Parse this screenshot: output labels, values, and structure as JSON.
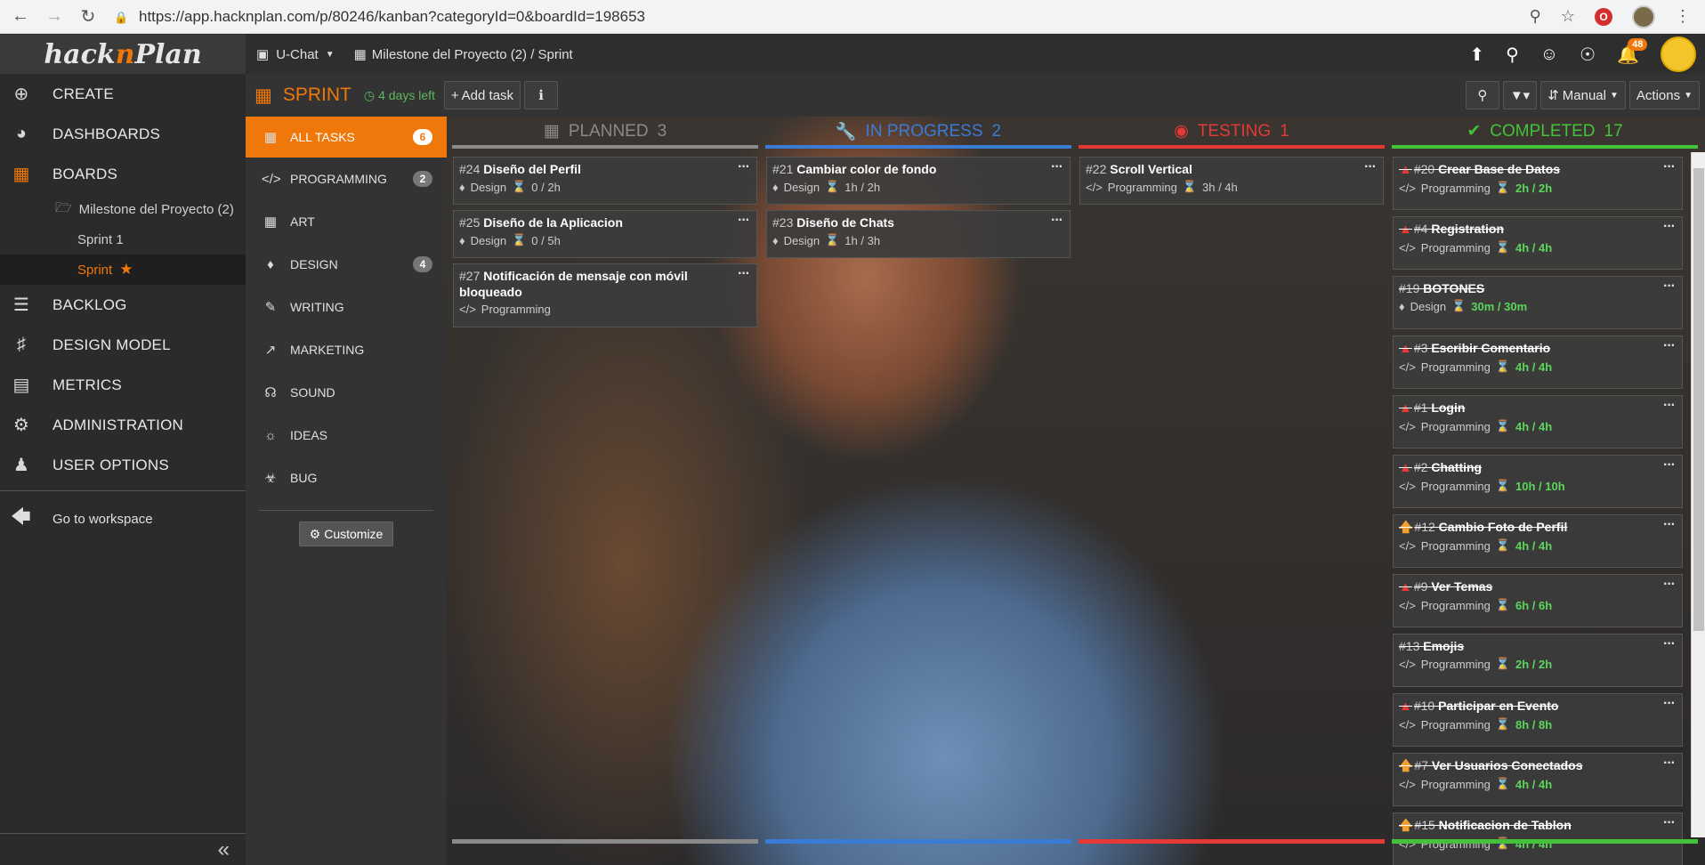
{
  "browser": {
    "url": "https://app.hacknplan.com/p/80246/kanban?categoryId=0&boardId=198653",
    "ext_label": "O"
  },
  "header": {
    "logo_a": "hack",
    "logo_n": "n",
    "logo_b": "Plan",
    "project": "U-Chat",
    "breadcrumb": "Milestone del Proyecto (2) / Sprint",
    "notif_count": "48"
  },
  "sidebar": {
    "items": [
      {
        "label": "CREATE",
        "icon": "plus-circle-icon"
      },
      {
        "label": "DASHBOARDS",
        "icon": "dashboard-icon"
      },
      {
        "label": "BOARDS",
        "icon": "boards-icon"
      },
      {
        "label": "BACKLOG",
        "icon": "list-icon"
      },
      {
        "label": "DESIGN MODEL",
        "icon": "sitemap-icon"
      },
      {
        "label": "METRICS",
        "icon": "chart-icon"
      },
      {
        "label": "ADMINISTRATION",
        "icon": "gear-icon"
      },
      {
        "label": "USER OPTIONS",
        "icon": "user-icon"
      }
    ],
    "milestone": "Milestone del Proyecto (2)",
    "sprint1": "Sprint 1",
    "sprint": "Sprint",
    "go_workspace": "Go to workspace"
  },
  "toolbar": {
    "title": "SPRINT",
    "days_left": "4 days left",
    "add_task": "Add task",
    "sort": "Manual",
    "actions": "Actions"
  },
  "categories": [
    {
      "label": "ALL TASKS",
      "count": "6"
    },
    {
      "label": "PROGRAMMING",
      "count": "2"
    },
    {
      "label": "ART",
      "count": ""
    },
    {
      "label": "DESIGN",
      "count": "4"
    },
    {
      "label": "WRITING",
      "count": ""
    },
    {
      "label": "MARKETING",
      "count": ""
    },
    {
      "label": "SOUND",
      "count": ""
    },
    {
      "label": "IDEAS",
      "count": ""
    },
    {
      "label": "BUG",
      "count": ""
    }
  ],
  "customize_label": "Customize",
  "columns": [
    {
      "label": "PLANNED",
      "count": "3",
      "color": "#8a8a8a"
    },
    {
      "label": "IN PROGRESS",
      "count": "2",
      "color": "#3a7bd5"
    },
    {
      "label": "TESTING",
      "count": "1",
      "color": "#e53935"
    },
    {
      "label": "COMPLETED",
      "count": "17",
      "color": "#43c23a"
    }
  ],
  "cards": {
    "planned": [
      {
        "num": "#24",
        "title": "Diseño del Perfil",
        "cat": "Design",
        "time": "0 / 2h"
      },
      {
        "num": "#25",
        "title": "Diseño de la Aplicacion",
        "cat": "Design",
        "time": "0 / 5h"
      },
      {
        "num": "#27",
        "title": "Notificación de mensaje con móvil bloqueado",
        "cat": "Programming",
        "time": ""
      }
    ],
    "inprogress": [
      {
        "num": "#21",
        "title": "Cambiar color de fondo",
        "cat": "Design",
        "time": "1h / 2h"
      },
      {
        "num": "#23",
        "title": "Diseño de Chats",
        "cat": "Design",
        "time": "1h / 3h"
      }
    ],
    "testing": [
      {
        "num": "#22",
        "title": "Scroll Vertical",
        "cat": "Programming",
        "time": "3h / 4h"
      }
    ],
    "completed": [
      {
        "num": "#20",
        "title": "Crear Base de Datos",
        "cat": "Programming",
        "time": "2h / 2h",
        "flag": "alert"
      },
      {
        "num": "#4",
        "title": "Registration",
        "cat": "Programming",
        "time": "4h / 4h",
        "flag": "alert"
      },
      {
        "num": "#19",
        "title": "BOTONES",
        "cat": "Design",
        "time": "30m / 30m",
        "flag": ""
      },
      {
        "num": "#3",
        "title": "Escribir Comentario",
        "cat": "Programming",
        "time": "4h / 4h",
        "flag": "alert"
      },
      {
        "num": "#1",
        "title": "Login",
        "cat": "Programming",
        "time": "4h / 4h",
        "flag": "alert"
      },
      {
        "num": "#2",
        "title": "Chatting",
        "cat": "Programming",
        "time": "10h / 10h",
        "flag": "alert"
      },
      {
        "num": "#12",
        "title": "Cambio Foto de Perfil",
        "cat": "Programming",
        "time": "4h / 4h",
        "flag": "up"
      },
      {
        "num": "#9",
        "title": "Ver Temas",
        "cat": "Programming",
        "time": "6h / 6h",
        "flag": "alert"
      },
      {
        "num": "#13",
        "title": "Emojis",
        "cat": "Programming",
        "time": "2h / 2h",
        "flag": ""
      },
      {
        "num": "#10",
        "title": "Participar en Evento",
        "cat": "Programming",
        "time": "8h / 8h",
        "flag": "alert"
      },
      {
        "num": "#7",
        "title": "Ver Usuarios Conectados",
        "cat": "Programming",
        "time": "4h / 4h",
        "flag": "up"
      },
      {
        "num": "#15",
        "title": "Notificacion de Tablon",
        "cat": "Programming",
        "time": "4h / 4h",
        "flag": "up"
      }
    ]
  }
}
